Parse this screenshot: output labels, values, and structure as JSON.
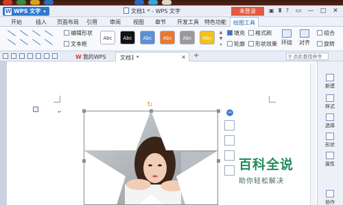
{
  "app": {
    "app_button": "WPS 文字",
    "document_title": "文档1 * - WPS 文字",
    "login_button": "未登录"
  },
  "ribbon_tabs": [
    "开始",
    "插入",
    "页面布局",
    "引用",
    "审阅",
    "视图",
    "章节",
    "开发工具",
    "特色功能",
    "绘图工具"
  ],
  "ribbon": {
    "edit_shape": "编辑形状",
    "text_box": "文本框",
    "style_swatches": [
      {
        "label": "Abc",
        "color": "#ffffff",
        "text_color": "#333333"
      },
      {
        "label": "Abc",
        "color": "#111111",
        "text_color": "#ffffff"
      },
      {
        "label": "Abc",
        "color": "#5b8fd4",
        "text_color": "#ffffff"
      },
      {
        "label": "Abc",
        "color": "#e8792e",
        "text_color": "#ffffff"
      },
      {
        "label": "Abc",
        "color": "#9a9a9a",
        "text_color": "#ffffff"
      },
      {
        "label": "Abc",
        "color": "#f2c21a",
        "text_color": "#ffffff"
      }
    ],
    "fill": "填充",
    "outline": "轮廓",
    "format_painter": "格式刷",
    "shape_effects": "形状效果",
    "wrap": "环绕",
    "align": "对齐",
    "group": "组合",
    "rotate": "旋转"
  },
  "doc_tabs": {
    "my_wps": "我的WPS",
    "doc1": "文档1 *",
    "search_placeholder": "点此查找命令"
  },
  "sidebar": {
    "items": [
      "新建",
      "样式",
      "选择",
      "形状",
      "属性",
      "协作"
    ]
  },
  "watermark": {
    "title": "百科全说",
    "subtitle": "助你轻松解决"
  }
}
